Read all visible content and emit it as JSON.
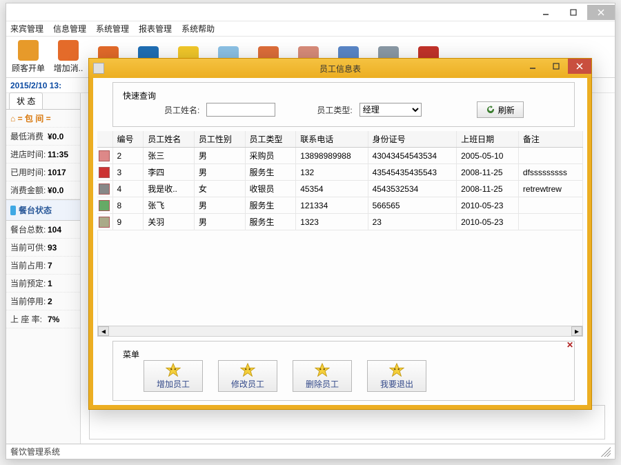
{
  "main": {
    "menus": [
      "来宾管理",
      "信息管理",
      "系统管理",
      "报表管理",
      "系统帮助"
    ],
    "toolbar": [
      {
        "label": "顾客开单",
        "color": "#e79a2a"
      },
      {
        "label": "增加消..",
        "color": "#e46b2a"
      },
      {
        "label": "",
        "color": "#e46b2a"
      },
      {
        "label": "",
        "color": "#1f6fb5"
      },
      {
        "label": "",
        "color": "#f2c82a"
      },
      {
        "label": "",
        "color": "#8cc2e6"
      },
      {
        "label": "",
        "color": "#de6e3a"
      },
      {
        "label": "",
        "color": "#d98c7a"
      },
      {
        "label": "",
        "color": "#5a87c8"
      },
      {
        "label": "",
        "color": "#8b9aa6"
      },
      {
        "label": "",
        "color": "#c3332a"
      }
    ],
    "datetime": "2015/2/10 13:",
    "status_tab": "状  态",
    "room_label": "= 包 间 =",
    "left_rows": [
      {
        "k": "最低消费",
        "v": "¥0.0"
      },
      {
        "k": "进店时间:",
        "v": "11:35"
      },
      {
        "k": "已用时间:",
        "v": "1017"
      },
      {
        "k": "消费金额:",
        "v": "¥0.0"
      }
    ],
    "section_title": "餐台状态",
    "stats": [
      {
        "k": "餐台总数:",
        "v": "104"
      },
      {
        "k": "当前可供:",
        "v": "93"
      },
      {
        "k": "当前占用:",
        "v": "7"
      },
      {
        "k": "当前预定:",
        "v": "1"
      },
      {
        "k": "当前停用:",
        "v": "2"
      },
      {
        "k": "上 座 率:",
        "v": "7%"
      }
    ],
    "statusbar": "餐饮管理系统"
  },
  "dialog": {
    "title": "员工信息表",
    "search_legend": "快速查询",
    "name_label": "员工姓名:",
    "name_value": "",
    "type_label": "员工类型:",
    "type_value": "经理",
    "type_options": [
      "经理"
    ],
    "refresh_label": "刷新",
    "columns": [
      "编号",
      "员工姓名",
      "员工性别",
      "员工类型",
      "联系电话",
      "身份证号",
      "上班日期",
      "备注"
    ],
    "rows": [
      {
        "id": "2",
        "name": "张三",
        "sex": "男",
        "type": "采购员",
        "phone": "13898989988",
        "idno": "43043454543534",
        "date": "2005-05-10",
        "remark": ""
      },
      {
        "id": "3",
        "name": "李四",
        "sex": "男",
        "type": "服务生",
        "phone": "132",
        "idno": "43545435435543",
        "date": "2008-11-25",
        "remark": "dfsssssssss"
      },
      {
        "id": "4",
        "name": "我是收..",
        "sex": "女",
        "type": "收银员",
        "phone": "45354",
        "idno": "4543532534",
        "date": "2008-11-25",
        "remark": "retrewtrew"
      },
      {
        "id": "8",
        "name": "张飞",
        "sex": "男",
        "type": "服务生",
        "phone": "121334",
        "idno": "566565",
        "date": "2010-05-23",
        "remark": ""
      },
      {
        "id": "9",
        "name": "关羽",
        "sex": "男",
        "type": "服务生",
        "phone": "1323",
        "idno": "23",
        "date": "2010-05-23",
        "remark": ""
      }
    ],
    "actions_legend": "菜单",
    "actions": [
      "增加员工",
      "修改员工",
      "删除员工",
      "我要退出"
    ]
  }
}
